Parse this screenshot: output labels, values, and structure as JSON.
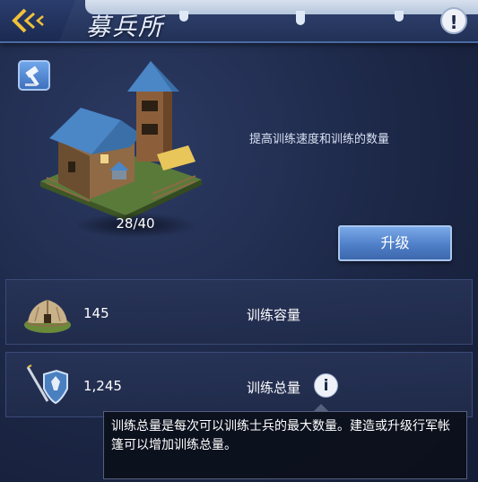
{
  "header": {
    "title": "募兵所",
    "back_icon": "back-arrow-icon",
    "info_icon": "info-icon"
  },
  "building": {
    "count": "28/40",
    "description": "提高训练速度和训练的数量"
  },
  "actions": {
    "upgrade_label": "升级"
  },
  "stats": [
    {
      "icon": "tent-icon",
      "value": "145",
      "label": "训练容量"
    },
    {
      "icon": "troops-icon",
      "value": "1,245",
      "label": "训练总量"
    }
  ],
  "tooltip": {
    "text": "训练总量是每次可以训练士兵的最大数量。建造或升级行军帐篷可以增加训练总量。"
  },
  "colors": {
    "accent_gold": "#f0c13a",
    "button_blue": "#4f7fc8",
    "bg_dark": "#1c2746"
  }
}
